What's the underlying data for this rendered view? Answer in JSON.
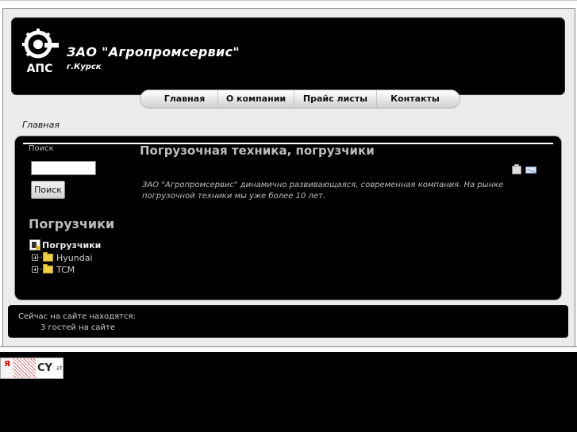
{
  "header": {
    "company_name": "ЗАО \"Агропромсервис\"",
    "city": "г.Курск",
    "logo_text": "АПС"
  },
  "nav": {
    "items": [
      {
        "label": "Главная"
      },
      {
        "label": "О компании"
      },
      {
        "label": "Прайс листы"
      },
      {
        "label": "Контакты"
      }
    ]
  },
  "breadcrumb": "Главная",
  "search": {
    "label": "Поиск",
    "input_value": "",
    "button_label": "Поиск"
  },
  "tree_module": {
    "title": "Погрузчики",
    "root_label": "Погрузчики",
    "children": [
      {
        "label": "Hyundai"
      },
      {
        "label": "TCM"
      }
    ]
  },
  "article": {
    "title": "Погрузочная техника, погрузчики",
    "text": "ЗАО \"Агропромсервис\" динамично развивающаяся, современная компания. На рынке погрузочной техники мы уже более 10 лет."
  },
  "footer": {
    "online_title": "Сейчас на сайте находятся:",
    "online_count": "3 гостей на сайте"
  },
  "counter": {
    "ya": "Я",
    "cy": "CY"
  },
  "colors": {
    "background": "#000000",
    "frame": "#ececec",
    "text_grey": "#bdbdbd"
  }
}
